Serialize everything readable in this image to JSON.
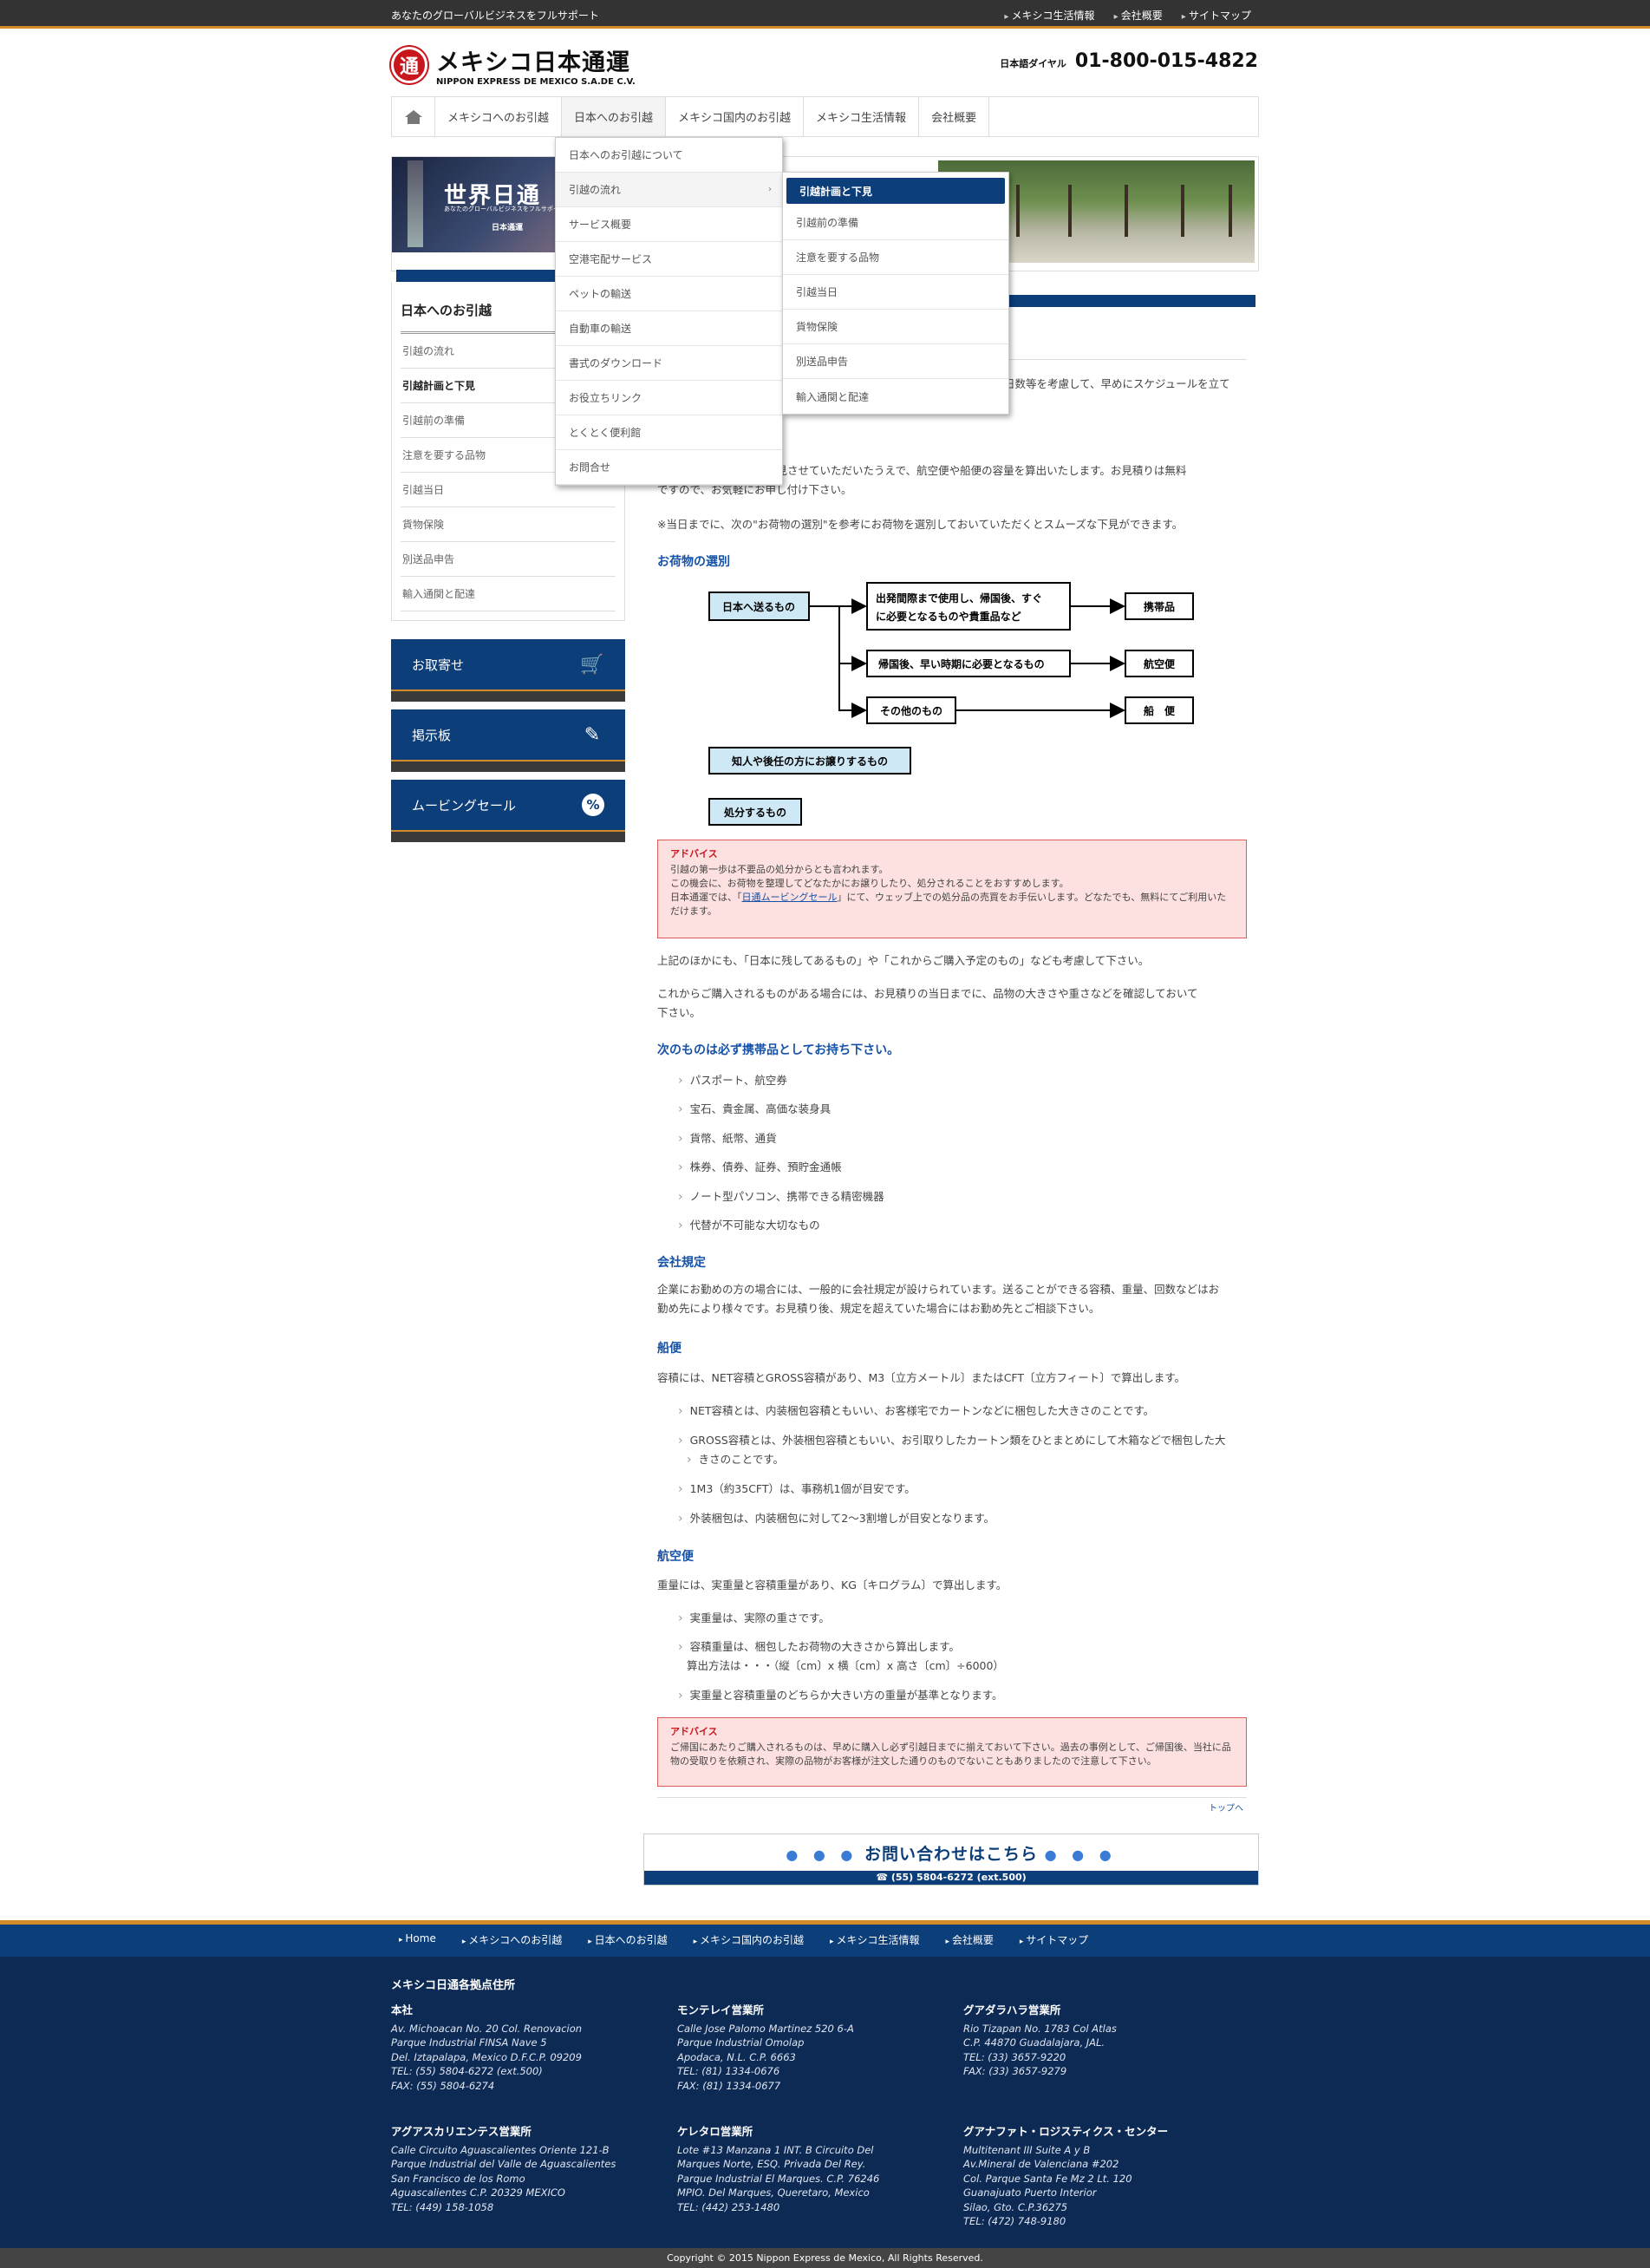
{
  "topbar": {
    "tagline": "あなたのグローバルビジネスをフルサポート",
    "links": [
      "メキシコ生活情報",
      "会社概要",
      "サイトマップ"
    ]
  },
  "logo": {
    "mark": "通",
    "name_jp": "メキシコ日本通運",
    "name_en": "NIPPON EXPRESS DE MEXICO S.A.DE C.V."
  },
  "phone": {
    "label": "日本語ダイヤル",
    "number": "01-800-015-4822"
  },
  "nav": [
    "メキシコへのお引越",
    "日本へのお引越",
    "メキシコ国内のお引越",
    "メキシコ生活情報",
    "会社概要"
  ],
  "dropdown": [
    "日本へのお引越について",
    "引越の流れ",
    "サービス概要",
    "空港宅配サービス",
    "ペットの輸送",
    "自動車の輸送",
    "書式のダウンロード",
    "お役立ちリンク",
    "とくとく便利館",
    "お問合せ"
  ],
  "submenu": [
    "引越計画と下見",
    "引越前の準備",
    "注意を要する品物",
    "引越当日",
    "貨物保険",
    "別送品申告",
    "輸入通関と配達"
  ],
  "banner": {
    "title": "世界日通",
    "sub": "あなたのグローバルビジネスをフルサポート",
    "brand": "日本通運"
  },
  "sidebar": {
    "title": "日本へのお引越",
    "items": [
      "引越の流れ",
      "引越計画と下見",
      "引越前の準備",
      "注意を要する品物",
      "引越当日",
      "貨物保険",
      "別送品申告",
      "輸入通関と配達"
    ]
  },
  "side_buttons": [
    "お取寄せ",
    "掲示板",
    "ムービングセール"
  ],
  "content": {
    "p_top_frag": "日数等を考慮して、早めにスケジュールを立て",
    "p2a": "物を拝見させていただいたうえで、航空便や船便の容量を算出いたします。お見積りは無料",
    "p2b": "ですので、お気軽にお申し付け下さい。",
    "p3": "※当日までに、次の\"お荷物の選別\"を参考にお荷物を選別しておいていただくとスムーズな下見ができます。",
    "h_select": "お荷物の選別",
    "flow": {
      "start": "日本へ送るもの",
      "b1a": "出発間際まで使用し、帰国後、すぐ",
      "b1b": "に必要となるものや貴重品など",
      "b2": "帰国後、早い時期に必要となるもの",
      "b3": "その他のもの",
      "r1": "携帯品",
      "r2": "航空便",
      "r3": "船　便",
      "s1": "知人や後任の方にお譲りするもの",
      "s2": "処分するもの"
    },
    "advice1": {
      "title": "アドバイス",
      "l1": "引越の第一歩は不要品の処分からとも言われます。",
      "l2": "この機会に、お荷物を整理してどなたかにお譲りしたり、処分されることをおすすめします。",
      "l3a": "日本通運では、「",
      "link": "日通ムービングセール",
      "l3b": "」にて、ウェッブ上での処分品の売買をお手伝いします。どなたでも、無料にてご利用いた",
      "l4": "だけます。"
    },
    "p4": "上記のほかにも、「日本に残してあるもの」や「これからご購入予定のもの」なども考慮して下さい。",
    "p5a": "これからご購入されるものがある場合には、お見積りの当日までに、品物の大きさや重さなどを確認しておいて",
    "p5b": "下さい。",
    "h_carry": "次のものは必ず携帯品としてお持ち下さい。",
    "carry": [
      "パスポート、航空券",
      "宝石、貴金属、高価な装身具",
      "貨幣、紙幣、通貨",
      "株券、債券、証券、預貯金通帳",
      "ノート型パソコン、携帯できる精密機器",
      "代替が不可能な大切なもの"
    ],
    "h_rule": "会社規定",
    "rule_a": "企業にお勤めの方の場合には、一般的に会社規定が設けられています。送ることができる容積、重量、回数などはお",
    "rule_b": "勤め先により様々です。お見積り後、規定を超えていた場合にはお勤め先とご相談下さい。",
    "h_ship": "船便",
    "ship_p": "容積には、NET容積とGROSS容積があり、M3〔立方メートル〕またはCFT〔立方フィート〕で算出します。",
    "ship_items": [
      "NET容積とは、内装梱包容積ともいい、お客様宅でカートンなどに梱包した大きさのことです。",
      "GROSS容積とは、外装梱包容積ともいい、お引取りしたカートン類をひとまとめにして木箱などで梱包した大",
      "きさのことです。",
      "1M3（約35CFT）は、事務机1個が目安です。",
      "外装梱包は、内装梱包に対して2～3割増しが目安となります。"
    ],
    "h_air": "航空便",
    "air_p": "重量には、実重量と容積重量があり、KG〔キログラム〕で算出します。",
    "air_items": [
      "実重量は、実際の重さです。",
      "容積重量は、梱包したお荷物の大きさから算出します。",
      "算出方法は・・・（縦〔cm〕x 横〔cm〕x 高さ〔cm〕÷6000）",
      "実重量と容積重量のどちらか大きい方の重量が基準となります。"
    ],
    "advice2": {
      "title": "アドバイス",
      "l1": "ご帰国にあたりご購入されるものは、早めに購入し必ず引越日までに揃えておいて下さい。過去の事例として、ご帰国後、当社に品",
      "l2": "物の受取りを依頼され、実際の品物がお客様が注文した通りのものでないこともありましたので注意して下さい。"
    },
    "totop": "トップへ"
  },
  "cta": {
    "dots": "● ● ●",
    "label": "お問い合わせはこちら",
    "tel": "☎ (55) 5804-6272 (ext.500)"
  },
  "footer_nav": [
    "Home",
    "メキシコへのお引越",
    "日本へのお引越",
    "メキシコ国内のお引越",
    "メキシコ生活情報",
    "会社概要",
    "サイトマップ"
  ],
  "footer": {
    "title": "メキシコ日通各拠点住所",
    "offices": [
      {
        "name": "本社",
        "lines": [
          "Av. Michoacan No. 20 Col. Renovacion",
          "Parque Industrial FINSA Nave 5",
          "Del. Iztapalapa, Mexico D.F.C.P. 09209",
          "TEL: (55) 5804-6272 (ext.500)",
          "FAX: (55) 5804-6274"
        ]
      },
      {
        "name": "モンテレイ営業所",
        "lines": [
          "Calle Jose Palomo Martinez 520 6-A",
          "Parque Industrial Omolap",
          "Apodaca, N.L. C.P. 6663",
          "TEL: (81) 1334-0676",
          "FAX: (81) 1334-0677"
        ]
      },
      {
        "name": "グアダラハラ営業所",
        "lines": [
          "Rio Tizapan No. 1783 Col Atlas",
          "C.P. 44870 Guadalajara, JAL.",
          "TEL: (33) 3657-9220",
          "FAX: (33) 3657-9279"
        ]
      },
      {
        "name": "アグアスカリエンテス営業所",
        "lines": [
          "Calle Circuito Aguascalientes Oriente 121-B",
          "Parque Industrial del Valle de Aguascalientes",
          "San Francisco de los Romo",
          "Aguascalientes C.P. 20329 MEXICO",
          "TEL: (449) 158-1058"
        ]
      },
      {
        "name": "ケレタロ営業所",
        "lines": [
          "Lote #13 Manzana 1 INT. B Circuito Del",
          "Marques Norte, ESQ. Privada Del Rey.",
          "Parque Industrial El Marques. C.P. 76246",
          "MPIO. Del Marques, Queretaro, Mexico",
          "TEL: (442) 253-1480"
        ]
      },
      {
        "name": "グアナファト・ロジスティクス・センター",
        "lines": [
          "Multitenant III Suite A y B",
          "Av.Mineral de Valenciana #202",
          "Col. Parque Santa Fe Mz 2 Lt. 120",
          "Guanajuato Puerto Interior",
          "Silao, Gto. C.P.36275",
          "TEL: (472) 748-9180"
        ]
      }
    ]
  },
  "copyright": "Copyright © 2015 Nippon Express de Mexico, All Rights Reserved."
}
